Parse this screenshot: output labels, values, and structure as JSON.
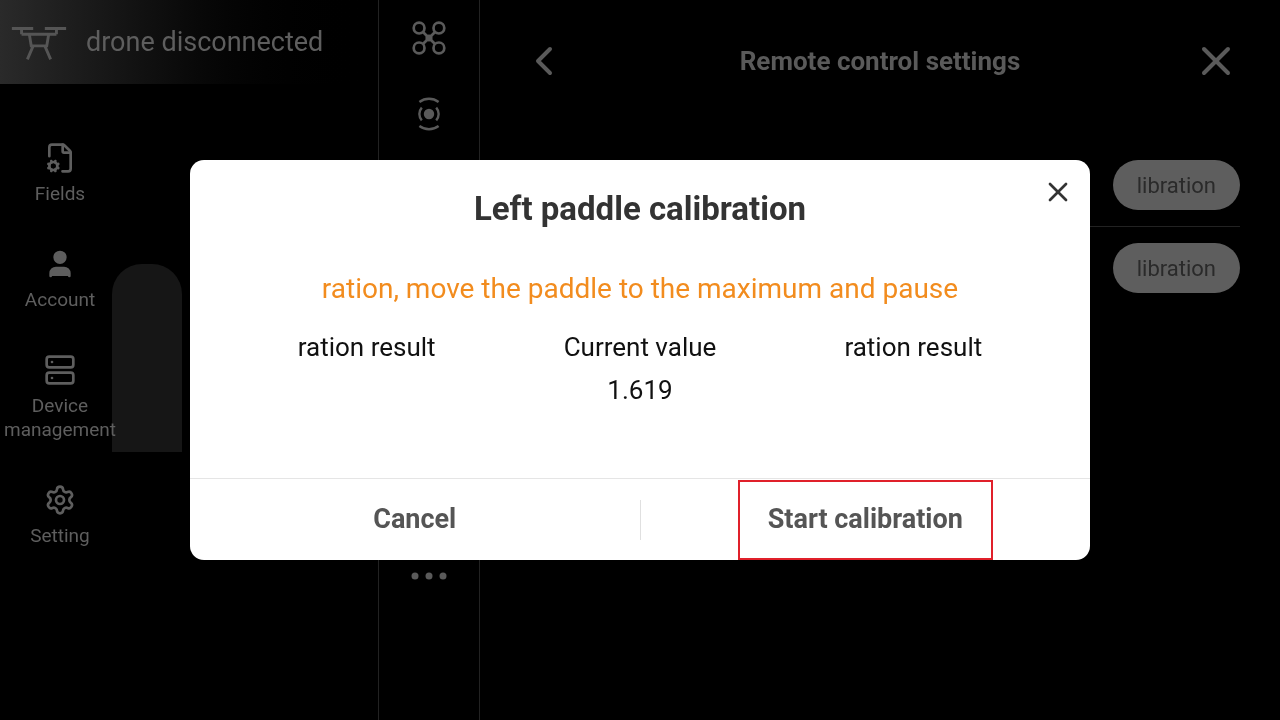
{
  "header": {
    "status": "drone disconnected"
  },
  "sidebar": {
    "items": [
      {
        "kind": "fields",
        "label": "Fields"
      },
      {
        "kind": "account",
        "label": "Account"
      },
      {
        "kind": "device",
        "label": "Device management"
      },
      {
        "kind": "setting",
        "label": "Setting"
      }
    ]
  },
  "rail": {
    "items": [
      {
        "kind": "drone"
      },
      {
        "kind": "remote"
      },
      {
        "kind": "more"
      }
    ]
  },
  "panel": {
    "title": "Remote control settings",
    "buttons": [
      "libration",
      "libration"
    ]
  },
  "dialog": {
    "title": "Left paddle calibration",
    "instruction": "ration, move the paddle to the maximum and pause",
    "columns": [
      {
        "label": "ration result"
      },
      {
        "label": "Current value",
        "value": "1.619"
      },
      {
        "label": "ration result"
      }
    ],
    "buttons": [
      {
        "label": "Cancel",
        "highlighted": false
      },
      {
        "label": "Start calibration",
        "highlighted": true
      }
    ]
  }
}
